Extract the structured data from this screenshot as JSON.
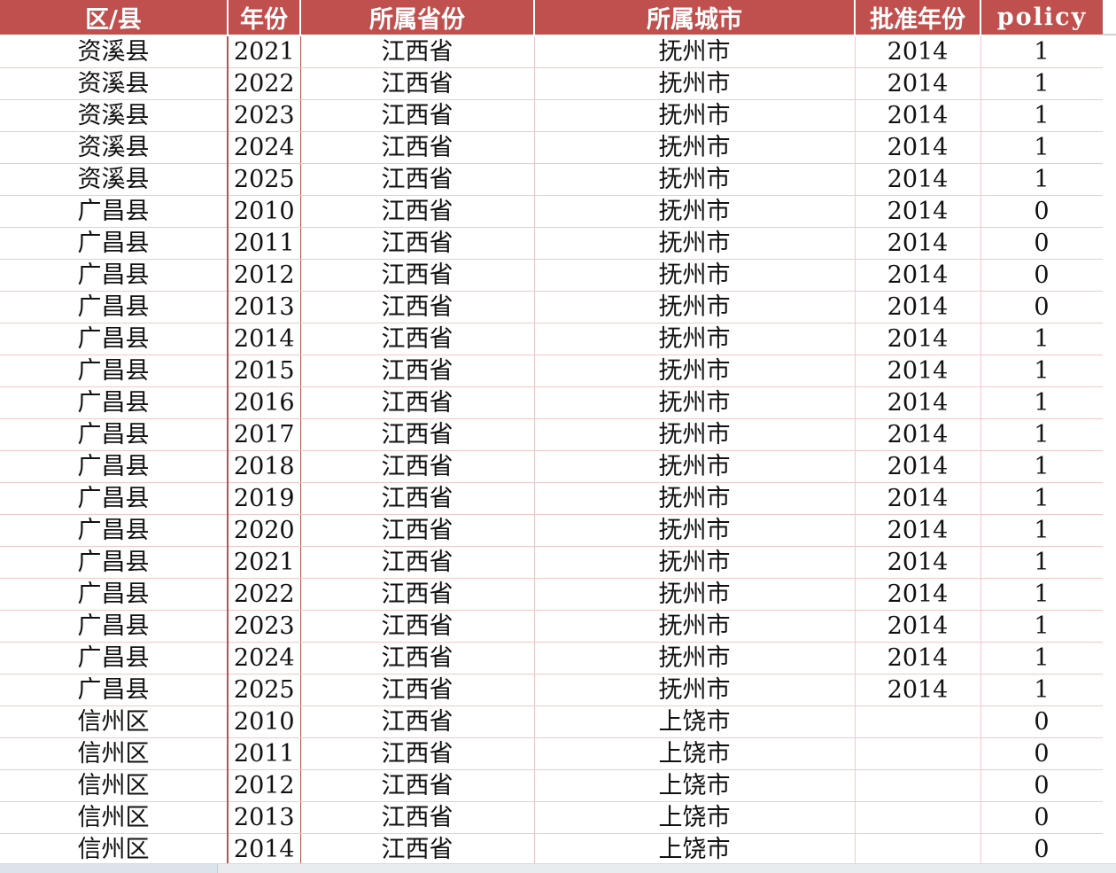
{
  "columns": [
    "区/县",
    "年份",
    "所属省份",
    "所属城市",
    "批准年份",
    "policy"
  ],
  "rows": [
    [
      "资溪县",
      "2021",
      "江西省",
      "抚州市",
      "2014",
      "1"
    ],
    [
      "资溪县",
      "2022",
      "江西省",
      "抚州市",
      "2014",
      "1"
    ],
    [
      "资溪县",
      "2023",
      "江西省",
      "抚州市",
      "2014",
      "1"
    ],
    [
      "资溪县",
      "2024",
      "江西省",
      "抚州市",
      "2014",
      "1"
    ],
    [
      "资溪县",
      "2025",
      "江西省",
      "抚州市",
      "2014",
      "1"
    ],
    [
      "广昌县",
      "2010",
      "江西省",
      "抚州市",
      "2014",
      "0"
    ],
    [
      "广昌县",
      "2011",
      "江西省",
      "抚州市",
      "2014",
      "0"
    ],
    [
      "广昌县",
      "2012",
      "江西省",
      "抚州市",
      "2014",
      "0"
    ],
    [
      "广昌县",
      "2013",
      "江西省",
      "抚州市",
      "2014",
      "0"
    ],
    [
      "广昌县",
      "2014",
      "江西省",
      "抚州市",
      "2014",
      "1"
    ],
    [
      "广昌县",
      "2015",
      "江西省",
      "抚州市",
      "2014",
      "1"
    ],
    [
      "广昌县",
      "2016",
      "江西省",
      "抚州市",
      "2014",
      "1"
    ],
    [
      "广昌县",
      "2017",
      "江西省",
      "抚州市",
      "2014",
      "1"
    ],
    [
      "广昌县",
      "2018",
      "江西省",
      "抚州市",
      "2014",
      "1"
    ],
    [
      "广昌县",
      "2019",
      "江西省",
      "抚州市",
      "2014",
      "1"
    ],
    [
      "广昌县",
      "2020",
      "江西省",
      "抚州市",
      "2014",
      "1"
    ],
    [
      "广昌县",
      "2021",
      "江西省",
      "抚州市",
      "2014",
      "1"
    ],
    [
      "广昌县",
      "2022",
      "江西省",
      "抚州市",
      "2014",
      "1"
    ],
    [
      "广昌县",
      "2023",
      "江西省",
      "抚州市",
      "2014",
      "1"
    ],
    [
      "广昌县",
      "2024",
      "江西省",
      "抚州市",
      "2014",
      "1"
    ],
    [
      "广昌县",
      "2025",
      "江西省",
      "抚州市",
      "2014",
      "1"
    ],
    [
      "信州区",
      "2010",
      "江西省",
      "上饶市",
      "",
      "0"
    ],
    [
      "信州区",
      "2011",
      "江西省",
      "上饶市",
      "",
      "0"
    ],
    [
      "信州区",
      "2012",
      "江西省",
      "上饶市",
      "",
      "0"
    ],
    [
      "信州区",
      "2013",
      "江西省",
      "上饶市",
      "",
      "0"
    ],
    [
      "信州区",
      "2014",
      "江西省",
      "上饶市",
      "",
      "0"
    ]
  ],
  "colors": {
    "header_bg": "#c0504d",
    "header_text": "#ffffff",
    "grid_line": "#f0c9c8"
  }
}
